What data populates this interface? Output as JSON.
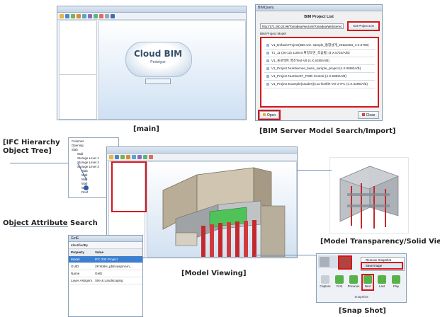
{
  "captions": {
    "main": "[main]",
    "bim_server": "[BIM Server Model Search/Import]",
    "ifc_tree": "[IFC Hierarchy\nObject Tree]",
    "attr_search": "Object Attribute Search",
    "model_transparency": "[Model Transparency/Solid View ]",
    "model_viewing": "[Model Viewing]",
    "snapshot": "[Snap Shot]"
  },
  "main_window": {
    "logo_title": "Cloud BIM",
    "logo_subtitle": "Prototype"
  },
  "bim_dialog": {
    "window_title": "BIMQuery",
    "header": "BIM Project List",
    "url_value": "http://172.200.22.96/TomaBear/sectors/TomaBearWebServic",
    "get_project_list": "Get Project List",
    "section_label": "BIM Project Model",
    "projects": [
      "V1_Default Project(BIM wiz. sample_통합설계_20111003_4.X.5708)",
      "T1_11 (20-1a) 1105 B 확정도면_조움빌) (4.X.5724/A/B)",
      "V1_프로젝트 영조Test-V8 (4.X.5285/A/B)",
      "V1_Project Numberone_basic_sample_project (4.X.5888/A/B)",
      "V1_Project Number57_PWE-Central (4.X.5883/A/B)",
      "V1_Project Example(sauder)(C11-hintfile-Ver-2-IFC (4.X.5295/A/B)"
    ],
    "open_label": "Open",
    "close_label": "Close"
  },
  "ifc_tree": {
    "items": [
      "Columns",
      "Opening",
      "Slab",
      "Wall",
      "Storage Level 1",
      "Storage Level 2",
      "Storage Level 3",
      "Slab",
      "Wall",
      "Wall",
      "Wall",
      "Wall",
      "Roof"
    ]
  },
  "attr_panel": {
    "title": "GetE",
    "filter_label": "IdentifiedBy",
    "columns": [
      "Property",
      "Value"
    ],
    "rows": [
      [
        "Model",
        "IFC 200 Project"
      ],
      [
        "GUID",
        "2Fmb8H_pbEvaspmAm..."
      ],
      [
        "Name",
        "GetE"
      ],
      [
        "Layer Assignm...",
        "Site & Landscaping"
      ]
    ]
  },
  "snapshot": {
    "menu_title": "Remove Snapshot",
    "menu_item": "Save image",
    "buttons": [
      "Capture",
      "First",
      "Previous",
      "Next",
      "Last",
      "Play"
    ],
    "group_label": "SnapShot"
  }
}
